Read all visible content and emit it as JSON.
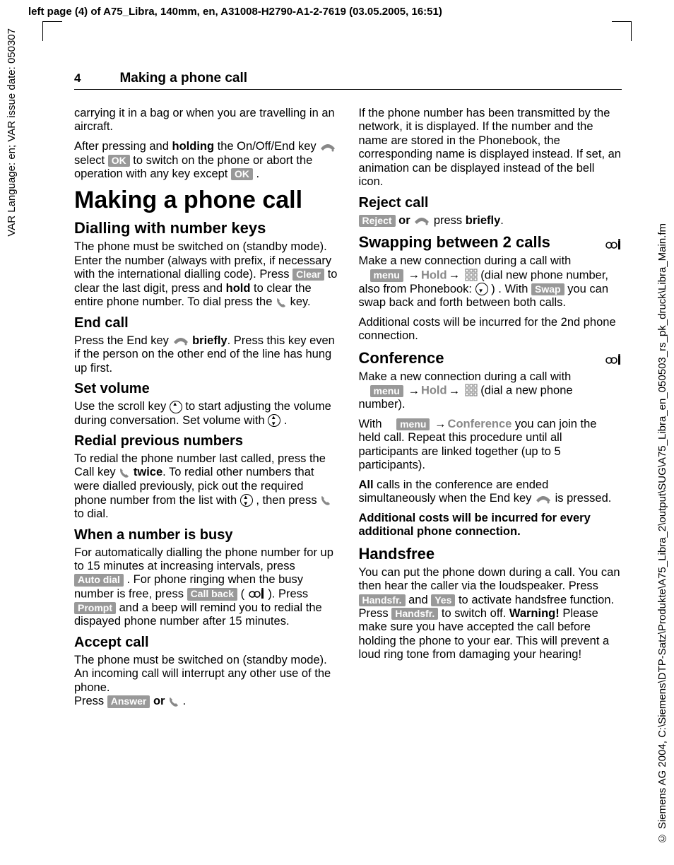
{
  "meta": {
    "topline": "left page (4) of A75_Libra, 140mm, en, A31008-H2790-A1-2-7619 (03.05.2005, 16:51)",
    "sideleft": "VAR Language: en; VAR issue date: 050307",
    "sideright": "© Siemens AG 2004, C:\\Siemens\\DTP-Satz\\Produkte\\A75_Libra_2\\output\\SUG\\A75_Libra_en_050503_rs_pk_druck\\Libra_Main.fm"
  },
  "header": {
    "pagenum": "4",
    "title": "Making a phone call"
  },
  "labels": {
    "OK": "OK",
    "Clear": "Clear",
    "AutoDial": "Auto dial",
    "Callback": "Call back",
    "Prompt": "Prompt",
    "Answer": "Answer",
    "Reject": "Reject",
    "menu": "menu",
    "Swap": "Swap",
    "Handsfr": "Handsfr.",
    "Yes": "Yes"
  },
  "greytxt": {
    "Hold": "Hold",
    "Conference": "Conference"
  },
  "t": {
    "p1a": "carrying it in a bag or when you are travelling in an aircraft.",
    "p2a": "After pressing and ",
    "holding": "holding",
    "p2b": " the On/Off/End key ",
    "p2c": " select ",
    "p2d": " to switch on the phone or abort the operation with any key except ",
    "h1": "Making a phone call",
    "h2a": "Dialling with number keys",
    "p3a": "The phone must be switched on (standby mode). Enter the number (always with prefix, if necessary with the international dialling code). Press ",
    "p3b": " to clear the last digit, press and ",
    "hold": "hold",
    "p3c": " to clear the entire phone number. To dial press the ",
    "p3d": " key.",
    "h3a": "End call",
    "p4a": "Press the End key ",
    "briefly": "briefly",
    "p4b": ". Press this key even if the person on the other end of the line has hung up first.",
    "h3b": "Set volume",
    "p5a": "Use the scroll key ",
    "p5b": " to start adjusting the volume during conversation. Set volume with ",
    "h3c": "Redial previous numbers",
    "p6a": "To redial the phone number last called, press the Call key ",
    "twice": "twice",
    "p6b": ". To redial other numbers that were dialled previously, pick out the required phone number from the list with ",
    "p6c": ",  then press ",
    "p6d": " to dial.",
    "h3d": "When a number is busy",
    "p7a": "For automatically dialling the phone number for up to 15 minutes at increasing intervals, press ",
    "p7b": ". For phone ringing when the busy number is free, press ",
    "p7c": " ( ",
    "p7d": " ). Press ",
    "p7e": " and a beep will remind you to redial the dispayed phone number after 15 minutes.",
    "h3e": "Accept call",
    "p8a": "The phone must be switched on (standby mode). An incoming call will interrupt any other use of the phone.",
    "p8b": "Press ",
    "or": "or",
    "p9": "If the phone number has been transmitted by the network, it is displayed. If the number and the name are stored in the Phonebook, the corresponding name is displayed instead. If set, an animation can be displayed instead of the bell icon.",
    "h3f": "Reject call",
    "p10a": " ",
    "p10b": " press ",
    "h3g": "Swapping between 2 calls",
    "p11a": "Make a new connection during a call with ",
    "p11b": " (dial new phone number, also from Phonebook: ",
    "p11c": ") . With ",
    "p11d": " you can swap back and forth between both calls.",
    "p12": "Additional costs will be incurred for the 2nd phone connection.",
    "h3h": "Conference",
    "p13a": "Make a new connection during a call with ",
    "p13b": " (dial a new phone number).",
    "p14a": "With ",
    "p14b": " you can join the held call. Repeat this procedure until all participants are linked together (up to 5 participants).",
    "p15a": "All",
    "p15b": " calls in the conference are ended simultaneously when the End key ",
    "p15c": " is pressed.",
    "p16": "Additional costs will be incurred for every additional phone connection.",
    "h3i": "Handsfree",
    "p17a": "You can put the phone down during a call. You can then hear the caller via the loudspeaker. Press ",
    "p17b": " and ",
    "p17c": " to activate handsfree function. Press ",
    "p17d": " to switch off. ",
    "warning": "Warning!",
    "p17e": " Please make sure you have accepted the call before holding the phone to your ear. This will prevent a loud ring tone from damaging your hearing!"
  }
}
